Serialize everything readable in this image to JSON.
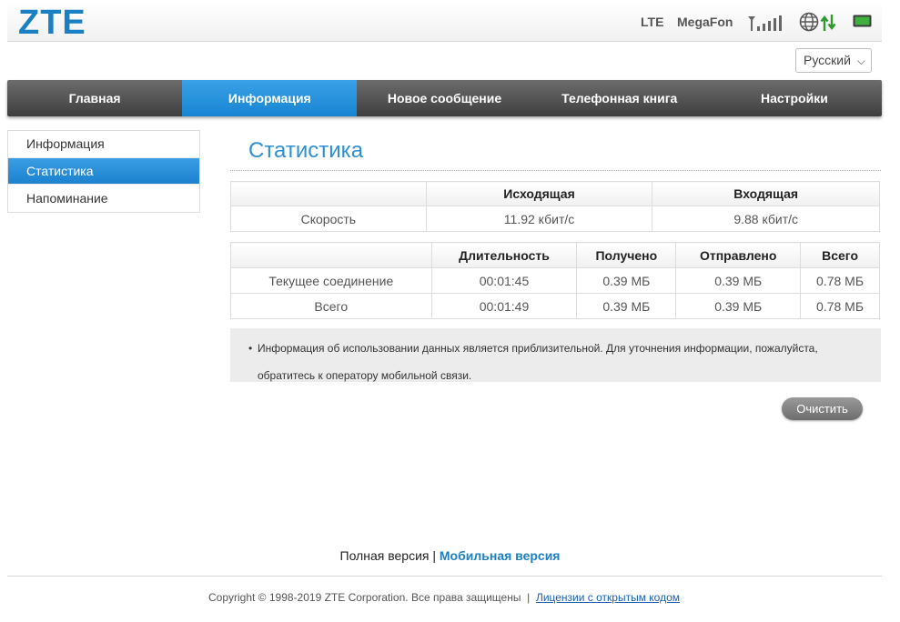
{
  "header": {
    "logo": "ZTE",
    "network_type": "LTE",
    "operator": "MegaFon",
    "signal_bars": 5,
    "signal_icon": "signal-strength-icon",
    "internet_icon": "globe-icon",
    "data_icon": "data-transfer-arrows-icon",
    "battery_icon": "battery-icon",
    "colors": {
      "accent": "#1b7fc4",
      "battery": "#2e9a2e",
      "arrows": "#2e9a2e"
    }
  },
  "language": {
    "selected": "Русский"
  },
  "nav": {
    "items": [
      {
        "label": "Главная"
      },
      {
        "label": "Информация"
      },
      {
        "label": "Новое сообщение"
      },
      {
        "label": "Телефонная книга"
      },
      {
        "label": "Настройки"
      }
    ],
    "active": "Информация"
  },
  "sidebar": {
    "items": [
      {
        "label": "Информация"
      },
      {
        "label": "Статистика"
      },
      {
        "label": "Напоминание"
      }
    ],
    "active": "Статистика"
  },
  "main": {
    "title": "Статистика",
    "speed_table": {
      "headers": [
        "",
        "Исходящая",
        "Входящая"
      ],
      "row": {
        "label": "Скорость",
        "outgoing": "11.92 кбит/с",
        "incoming": "9.88 кбит/с"
      }
    },
    "usage_table": {
      "headers": [
        "",
        "Длительность",
        "Получено",
        "Отправлено",
        "Всего"
      ],
      "rows": [
        {
          "label": "Текущее соединение",
          "duration": "00:01:45",
          "received": "0.39 МБ",
          "sent": "0.39 МБ",
          "total": "0.78 МБ"
        },
        {
          "label": "Всего",
          "duration": "00:01:49",
          "received": "0.39 МБ",
          "sent": "0.39 МБ",
          "total": "0.78 МБ"
        }
      ]
    },
    "note_line1": "Информация об использовании данных является приблизительной. Для уточнения информации, пожалуйста,",
    "note_line2": "обратитесь к оператору мобильной связи.",
    "clear_button": "Очистить"
  },
  "footer": {
    "full_version": "Полная версия",
    "separator": "|",
    "mobile_version": "Мобильная версия",
    "copyright": "Copyright © 1998-2019 ZTE Corporation. Все права защищены",
    "copyright_separator": "|",
    "license_link": "Лицензии с открытым кодом"
  }
}
